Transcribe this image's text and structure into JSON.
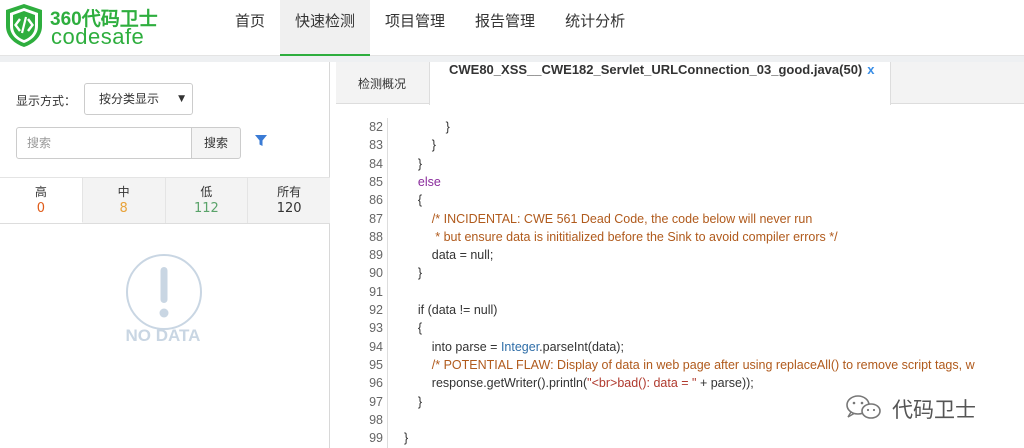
{
  "brand": {
    "name_cn": "360代码卫士",
    "name_en": "codesafe",
    "color": "#2eae3e"
  },
  "nav": [
    {
      "label": "首页"
    },
    {
      "label": "快速检测",
      "active": true
    },
    {
      "label": "项目管理"
    },
    {
      "label": "报告管理"
    },
    {
      "label": "统计分析"
    }
  ],
  "left": {
    "display_label": "显示方式：",
    "display_value": "按分类显示",
    "search_placeholder": "搜索",
    "search_button": "搜索",
    "severity_tabs": [
      {
        "name": "高",
        "count": "0",
        "color": "#e05c1a"
      },
      {
        "name": "中",
        "count": "8",
        "color": "#e8a33a"
      },
      {
        "name": "低",
        "count": "112",
        "color": "#5aa36a"
      },
      {
        "name": "所有",
        "count": "120",
        "color": "#333333"
      }
    ],
    "empty_text": "NO DATA"
  },
  "right": {
    "tab_overview": "检测概况",
    "tab_file": "CWE80_XSS__CWE182_Servlet_URLConnection_03_good.java(50)",
    "tab_close": "x"
  },
  "code_lines": [
    {
      "n": "82",
      "text": "            }"
    },
    {
      "n": "83",
      "text": "        }"
    },
    {
      "n": "84",
      "text": "    }"
    },
    {
      "n": "85",
      "text": "    else",
      "cls": "kw"
    },
    {
      "n": "86",
      "text": "    {"
    },
    {
      "n": "87",
      "text": "        /* INCIDENTAL: CWE 561 Dead Code, the code below will never run",
      "cls": "cm"
    },
    {
      "n": "88",
      "text": "         * but ensure data is inititialized before the Sink to avoid compiler errors */",
      "cls": "cm"
    },
    {
      "n": "89",
      "text": "        data = null;"
    },
    {
      "n": "90",
      "text": "    }"
    },
    {
      "n": "91",
      "text": ""
    },
    {
      "n": "92",
      "text": "    if (data != null)"
    },
    {
      "n": "93",
      "text": "    {"
    },
    {
      "n": "94",
      "parts": [
        {
          "t": "        into parse = "
        },
        {
          "t": "Integer",
          "cls": "ty"
        },
        {
          "t": ".parseInt(data);"
        }
      ]
    },
    {
      "n": "95",
      "text": "        /* POTENTIAL FLAW: Display of data in web page after using replaceAll() to remove script tags, w",
      "cls": "cm"
    },
    {
      "n": "96",
      "parts": [
        {
          "t": "        response.getWriter().println("
        },
        {
          "t": "\"<br>bad(): data = \"",
          "cls": "st"
        },
        {
          "t": " + parse));"
        }
      ]
    },
    {
      "n": "97",
      "text": "    }"
    },
    {
      "n": "98",
      "text": ""
    },
    {
      "n": "99",
      "text": "}"
    }
  ],
  "watermark": {
    "text": "代码卫士"
  }
}
